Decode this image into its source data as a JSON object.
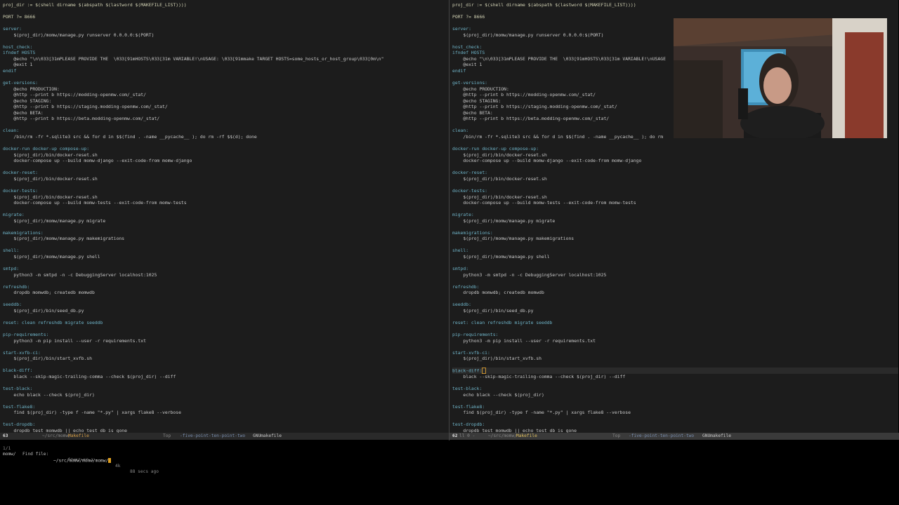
{
  "left_pane": {
    "lines": [
      {
        "text": "proj_dir := $(shell dirname $(abspath $(lastword $(MAKEFILE_LIST))))",
        "kind": "h"
      },
      {
        "text": "",
        "kind": ""
      },
      {
        "text": "PORT ?= 8666",
        "kind": "h"
      },
      {
        "text": "",
        "kind": ""
      },
      {
        "text": "server:",
        "kind": "t"
      },
      {
        "text": "    $(proj_dir)/momw/manage.py runserver 0.0.0.0:$(PORT)",
        "kind": ""
      },
      {
        "text": "",
        "kind": ""
      },
      {
        "text": "host_check:",
        "kind": "t"
      },
      {
        "text": "ifndef HOSTS",
        "kind": "t"
      },
      {
        "text": "    @echo \"\\n\\033[31mPLEASE PROVIDE THE  \\033[91mHOSTS\\033[31m VARIABLE!\\nUSAGE: \\033[91mmake TARGET HOSTS=some_hosts_or_host_group\\033[0m\\n\"",
        "kind": ""
      },
      {
        "text": "    @exit 1",
        "kind": ""
      },
      {
        "text": "endif",
        "kind": "t"
      },
      {
        "text": "",
        "kind": ""
      },
      {
        "text": "get-versions:",
        "kind": "t"
      },
      {
        "text": "    @echo PRODUCTION:",
        "kind": ""
      },
      {
        "text": "    @http --print b https://modding-openmw.com/_stat/",
        "kind": ""
      },
      {
        "text": "    @echo STAGING:",
        "kind": ""
      },
      {
        "text": "    @http --print b https://staging.modding-openmw.com/_stat/",
        "kind": ""
      },
      {
        "text": "    @echo BETA:",
        "kind": ""
      },
      {
        "text": "    @http --print b https://beta.modding-openmw.com/_stat/",
        "kind": ""
      },
      {
        "text": "",
        "kind": ""
      },
      {
        "text": "clean:",
        "kind": "t"
      },
      {
        "text": "    /bin/rm -fr *.sqlite3 src && for d in $$(find . -name __pycache__ ); do rm -rf $$(d); done",
        "kind": ""
      },
      {
        "text": "",
        "kind": ""
      },
      {
        "text": "docker-run docker-up compose-up:",
        "kind": "t"
      },
      {
        "text": "    $(proj_dir)/bin/docker-reset.sh",
        "kind": ""
      },
      {
        "text": "    docker-compose up --build momw-django --exit-code-from momw-django",
        "kind": ""
      },
      {
        "text": "",
        "kind": ""
      },
      {
        "text": "docker-reset:",
        "kind": "t"
      },
      {
        "text": "    $(proj_dir)/bin/docker-reset.sh",
        "kind": ""
      },
      {
        "text": "",
        "kind": ""
      },
      {
        "text": "docker-tests:",
        "kind": "t"
      },
      {
        "text": "    $(proj_dir)/bin/docker-reset.sh",
        "kind": ""
      },
      {
        "text": "    docker-compose up --build momw-tests --exit-code-from momw-tests",
        "kind": ""
      },
      {
        "text": "",
        "kind": ""
      },
      {
        "text": "migrate:",
        "kind": "t"
      },
      {
        "text": "    $(proj_dir)/momw/manage.py migrate",
        "kind": ""
      },
      {
        "text": "",
        "kind": ""
      },
      {
        "text": "makemigrations:",
        "kind": "t"
      },
      {
        "text": "    $(proj_dir)/momw/manage.py makemigrations",
        "kind": ""
      },
      {
        "text": "",
        "kind": ""
      },
      {
        "text": "shell:",
        "kind": "t"
      },
      {
        "text": "    $(proj_dir)/momw/manage.py shell",
        "kind": ""
      },
      {
        "text": "",
        "kind": ""
      },
      {
        "text": "smtpd:",
        "kind": "t"
      },
      {
        "text": "    python3 -m smtpd -n -c DebuggingServer localhost:1025",
        "kind": ""
      },
      {
        "text": "",
        "kind": ""
      },
      {
        "text": "refreshdb:",
        "kind": "t"
      },
      {
        "text": "    dropdb momwdb; createdb momwdb",
        "kind": ""
      },
      {
        "text": "",
        "kind": ""
      },
      {
        "text": "seeddb:",
        "kind": "t"
      },
      {
        "text": "    $(proj_dir)/bin/seed_db.py",
        "kind": ""
      },
      {
        "text": "",
        "kind": ""
      },
      {
        "text": "reset: clean refreshdb migrate seeddb",
        "kind": "t"
      },
      {
        "text": "",
        "kind": ""
      },
      {
        "text": "pip-requirements:",
        "kind": "t"
      },
      {
        "text": "    python3 -m pip install --user -r requirements.txt",
        "kind": ""
      },
      {
        "text": "",
        "kind": ""
      },
      {
        "text": "start-xvfb-ci:",
        "kind": "t"
      },
      {
        "text": "    $(proj_dir)/bin/start_xvfb.sh",
        "kind": ""
      },
      {
        "text": "",
        "kind": ""
      },
      {
        "text": "black-diff:",
        "kind": "t"
      },
      {
        "text": "    black --skip-magic-trailing-comma --check $(proj_dir) --diff",
        "kind": ""
      },
      {
        "text": "",
        "kind": ""
      },
      {
        "text": "test-black:",
        "kind": "t"
      },
      {
        "text": "    echo black --check $(proj_dir)",
        "kind": ""
      },
      {
        "text": "",
        "kind": ""
      },
      {
        "text": "test-flake8:",
        "kind": "t"
      },
      {
        "text": "    find $(proj_dir) -type f -name \"*.py\" | xargs flake8 --verbose",
        "kind": ""
      },
      {
        "text": "",
        "kind": ""
      },
      {
        "text": "test-dropdb:",
        "kind": "t"
      },
      {
        "text": "    dropdb test_momwdb || echo test db is gone",
        "kind": ""
      }
    ]
  },
  "right_pane": {
    "lines": [
      {
        "text": "proj_dir := $(shell dirname $(abspath $(lastword $(MAKEFILE_LIST))))",
        "kind": "h"
      },
      {
        "text": "",
        "kind": ""
      },
      {
        "text": "PORT ?= 8666",
        "kind": "h"
      },
      {
        "text": "",
        "kind": ""
      },
      {
        "text": "server:",
        "kind": "t"
      },
      {
        "text": "    $(proj_dir)/momw/manage.py runserver 0.0.0.0:$(PORT)",
        "kind": ""
      },
      {
        "text": "",
        "kind": ""
      },
      {
        "text": "host_check:",
        "kind": "t"
      },
      {
        "text": "ifndef HOSTS",
        "kind": "t"
      },
      {
        "text": "    @echo \"\\n\\033[31mPLEASE PROVIDE THE  \\033[91mHOSTS\\033[31m VARIABLE!\\nUSAGE",
        "kind": ""
      },
      {
        "text": "    @exit 1",
        "kind": ""
      },
      {
        "text": "endif",
        "kind": "t"
      },
      {
        "text": "",
        "kind": ""
      },
      {
        "text": "get-versions:",
        "kind": "t"
      },
      {
        "text": "    @echo PRODUCTION:",
        "kind": ""
      },
      {
        "text": "    @http --print b https://modding-openmw.com/_stat/",
        "kind": ""
      },
      {
        "text": "    @echo STAGING:",
        "kind": ""
      },
      {
        "text": "    @http --print b https://staging.modding-openmw.com/_stat/",
        "kind": ""
      },
      {
        "text": "    @echo BETA:",
        "kind": ""
      },
      {
        "text": "    @http --print b https://beta.modding-openmw.com/_stat/",
        "kind": ""
      },
      {
        "text": "",
        "kind": ""
      },
      {
        "text": "clean:",
        "kind": "t"
      },
      {
        "text": "    /bin/rm -fr *.sqlite3 src && for d in $$(find . -name __pycache__ ); do rm",
        "kind": ""
      },
      {
        "text": "",
        "kind": ""
      },
      {
        "text": "docker-run docker-up compose-up:",
        "kind": "t"
      },
      {
        "text": "    $(proj_dir)/bin/docker-reset.sh",
        "kind": ""
      },
      {
        "text": "    docker-compose up --build momw-django --exit-code-from momw-django",
        "kind": ""
      },
      {
        "text": "",
        "kind": ""
      },
      {
        "text": "docker-reset:",
        "kind": "t"
      },
      {
        "text": "    $(proj_dir)/bin/docker-reset.sh",
        "kind": ""
      },
      {
        "text": "",
        "kind": ""
      },
      {
        "text": "docker-tests:",
        "kind": "t"
      },
      {
        "text": "    $(proj_dir)/bin/docker-reset.sh",
        "kind": ""
      },
      {
        "text": "    docker-compose up --build momw-tests --exit-code-from momw-tests",
        "kind": ""
      },
      {
        "text": "",
        "kind": ""
      },
      {
        "text": "migrate:",
        "kind": "t"
      },
      {
        "text": "    $(proj_dir)/momw/manage.py migrate",
        "kind": ""
      },
      {
        "text": "",
        "kind": ""
      },
      {
        "text": "makemigrations:",
        "kind": "t"
      },
      {
        "text": "    $(proj_dir)/momw/manage.py makemigrations",
        "kind": ""
      },
      {
        "text": "",
        "kind": ""
      },
      {
        "text": "shell:",
        "kind": "t"
      },
      {
        "text": "    $(proj_dir)/momw/manage.py shell",
        "kind": ""
      },
      {
        "text": "",
        "kind": ""
      },
      {
        "text": "smtpd:",
        "kind": "t"
      },
      {
        "text": "    python3 -m smtpd -n -c DebuggingServer localhost:1025",
        "kind": ""
      },
      {
        "text": "",
        "kind": ""
      },
      {
        "text": "refreshdb:",
        "kind": "t"
      },
      {
        "text": "    dropdb momwdb; createdb momwdb",
        "kind": ""
      },
      {
        "text": "",
        "kind": ""
      },
      {
        "text": "seeddb:",
        "kind": "t"
      },
      {
        "text": "    $(proj_dir)/bin/seed_db.py",
        "kind": ""
      },
      {
        "text": "",
        "kind": ""
      },
      {
        "text": "reset: clean refreshdb migrate seeddb",
        "kind": "t"
      },
      {
        "text": "",
        "kind": ""
      },
      {
        "text": "pip-requirements:",
        "kind": "t"
      },
      {
        "text": "    python3 -m pip install --user -r requirements.txt",
        "kind": ""
      },
      {
        "text": "",
        "kind": ""
      },
      {
        "text": "start-xvfb-ci:",
        "kind": "t"
      },
      {
        "text": "    $(proj_dir)/bin/start_xvfb.sh",
        "kind": ""
      },
      {
        "text": "",
        "kind": ""
      },
      {
        "text": "black-diff:",
        "kind": "t",
        "current": true
      },
      {
        "text": "    black --skip-magic-trailing-comma --check $(proj_dir) --diff",
        "kind": ""
      },
      {
        "text": "",
        "kind": ""
      },
      {
        "text": "test-black:",
        "kind": "t"
      },
      {
        "text": "    echo black --check $(proj_dir)",
        "kind": ""
      },
      {
        "text": "",
        "kind": ""
      },
      {
        "text": "test-flake8:",
        "kind": "t"
      },
      {
        "text": "    find $(proj_dir) -type f -name \"*.py\" | xargs flake8 --verbose",
        "kind": ""
      },
      {
        "text": "",
        "kind": ""
      },
      {
        "text": "test-dropdb:",
        "kind": "t"
      },
      {
        "text": "    dropdb test_momwdb || echo test db is gone",
        "kind": ""
      }
    ]
  },
  "modeline_left": {
    "line_no": "63",
    "dir": "~/src/momw/",
    "name": "Makefile",
    "position": "Top",
    "branch": "-five-point-ten-point-two",
    "mode": "GNUmakefile"
  },
  "modeline_right": {
    "line_no": "62",
    "info": "ll 0 -",
    "dir": "~/src/momw/",
    "name": "Makefile",
    "position": "Top",
    "branch": "-five-point-ten-point-two",
    "mode": "GNUmakefile"
  },
  "minibuffer": {
    "count": "1/1",
    "prompt": "Find file: ",
    "value": "~/src/momw/momw/momw/",
    "candidate": "momw/",
    "perms": "drwxr-xr-x",
    "size": "4k",
    "age": "88 secs ago"
  },
  "webcam": {
    "description_icon": "webcam-person-icon"
  },
  "colors": {
    "editor_bg": "#1c1c1c",
    "target": "#6fb4c8",
    "modeline_active": "#3a3a3a",
    "file_name": "#d8a048",
    "cursor": "#e0a020"
  }
}
